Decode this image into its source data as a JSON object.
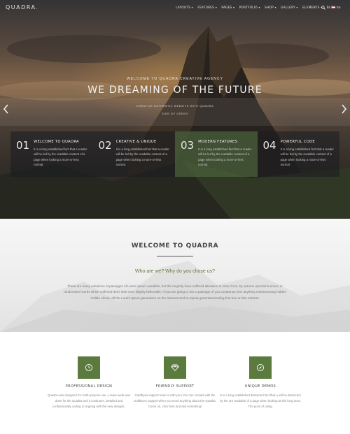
{
  "brand": {
    "logo_text": "QUADRA",
    "logo_dot": "."
  },
  "nav": {
    "items": [
      {
        "label": "LAYOUTS"
      },
      {
        "label": "FEATURES"
      },
      {
        "label": "PAGES"
      },
      {
        "label": "PORTFOLIO"
      },
      {
        "label": "SHOP"
      },
      {
        "label": "GALLERY"
      },
      {
        "label": "ELEMENTS"
      },
      {
        "label": "BLOG"
      }
    ],
    "search_icon": "search-icon",
    "language": {
      "code": "En",
      "icon": "flag-us-icon"
    }
  },
  "hero": {
    "welcome": "WELCOME TO QUADRA CREATIVE AGENCY",
    "title": "WE DREAMING OF THE FUTURE",
    "subtitle": "CREATIVE AUTHENTIC WEBSITE WITH QUADRA",
    "link": "SIDE OF GREEN",
    "prev_icon": "chevron-left-icon",
    "next_icon": "chevron-right-icon"
  },
  "features": [
    {
      "num": "01",
      "title": "WELCOME TO QUADRA",
      "text": "It is a long established fact that a reader will be led by the readable content of a page when looking a more-or-less normal."
    },
    {
      "num": "02",
      "title": "CREATIVE & UNIQUE",
      "text": "It is a long established fact that a reader will be led by the readable content of a page when looking a more-or-less normal."
    },
    {
      "num": "03",
      "title": "MODERN FEATURES",
      "text": "It is a long established fact that a reader will be led by the readable content of a page when looking a more-or-less normal."
    },
    {
      "num": "04",
      "title": "POWERFUL CODE",
      "text": "It is a long established fact that a reader will be led by the readable content of a page when looking a more-or-less normal."
    }
  ],
  "welcome_section": {
    "title": "WELCOME TO QUADRA",
    "subtitle": "Who are we? Why do you chose us?",
    "paragraph": "There are many variations of passages of Lorem Ipsum available, but the majority have suffered alteration in some form, by automo injected humour, or randomised words which sufferied don't look even slightly believable. If you are going to use a passage of you condamue isn't anything embarrassing hidden middle of text. All the Lorem Ipsum generators on the Internet tend to repeat generatorsreallng first true on the Internet."
  },
  "services": [
    {
      "icon": "clock-icon",
      "title": "PROFESSIONAL DESIGN",
      "text": "Quadra was designed for multi-purpose use. A team work was done for the Quadra and it continues. Detailed and professionally coding is ongoing with the new designs."
    },
    {
      "icon": "diamond-icon",
      "title": "FRIENDLY SUPPORT",
      "text": "GoldEyes support team is with you! You can contact with the GoldEyes support when you need anything about the Quadra. Come on, click here and ask something!"
    },
    {
      "icon": "compass-icon",
      "title": "UNIQUE DEMOS",
      "text": "It is a long established distracted fact that a will be distracted by the are readable of a page when looking at this long texts. The point of using."
    }
  ],
  "colors": {
    "accent": "#5b7a3e",
    "active_feature": "#485e3a",
    "link_green": "#5f7a3f"
  }
}
